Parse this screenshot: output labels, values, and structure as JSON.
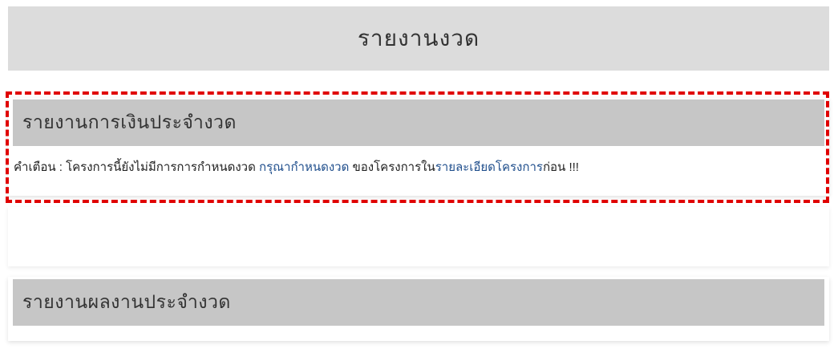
{
  "header": {
    "title": "รายงานงวด"
  },
  "finance_panel": {
    "title": "รายงานการเงินประจำงวด",
    "warning": {
      "prefix": "คำเตือน : โครงการนี้ยังไม่มีการการกำหนดงวด ",
      "link1": "กรุณากำหนดงวด",
      "middle": " ของโครงการใน",
      "link2": "รายละเอียดโครงการ",
      "suffix": "ก่อน !!!"
    }
  },
  "work_panel": {
    "title": "รายงานผลงานประจำงวด"
  },
  "colors": {
    "header_bg": "#dcdcdc",
    "panel_heading_bg": "#c6c6c6",
    "link": "#1f4e8c",
    "highlight_border": "#e00000"
  }
}
